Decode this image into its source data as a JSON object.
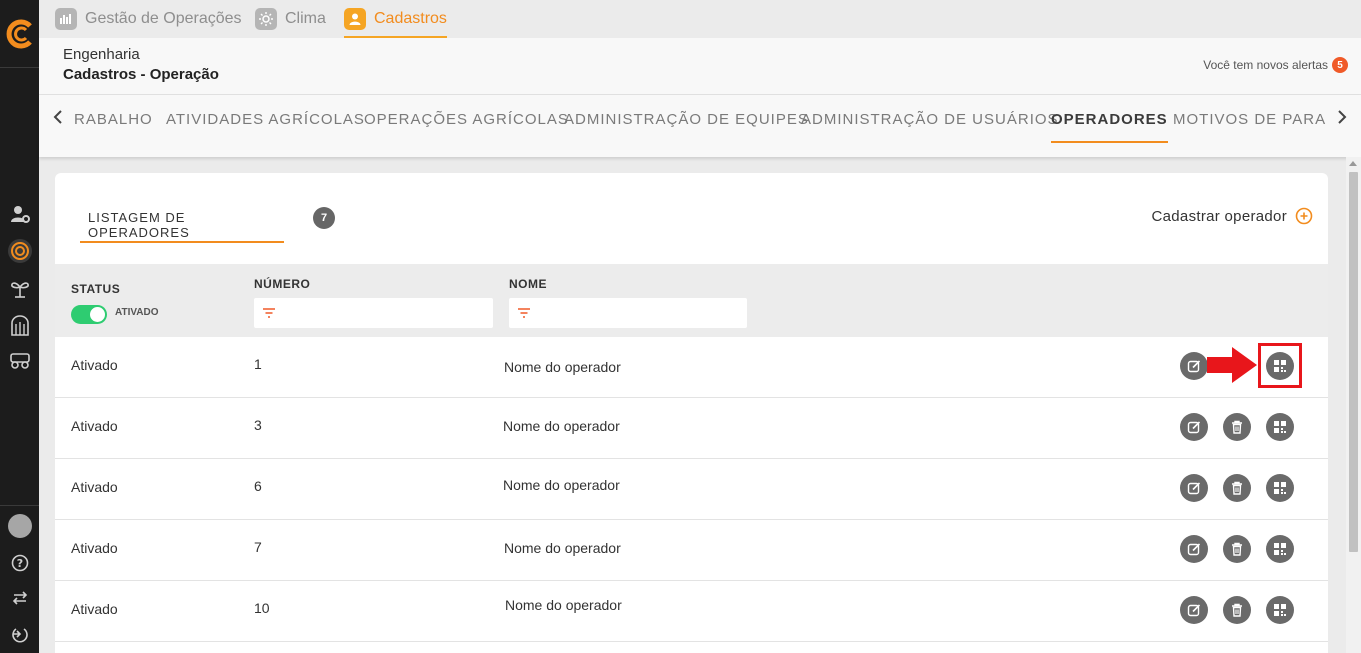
{
  "top_tabs": [
    {
      "label": "Gestão de Operações",
      "icon": "chart-icon"
    },
    {
      "label": "Clima",
      "icon": "sun-icon"
    },
    {
      "label": "Cadastros",
      "icon": "user-icon"
    }
  ],
  "header": {
    "breadcrumb_1": "Engenharia",
    "breadcrumb_2": "Cadastros - Operação",
    "alerts_text": "Você tem novos alertas",
    "alerts_count": "5"
  },
  "sub_tabs": [
    "RABALHO",
    "ATIVIDADES AGRÍCOLAS",
    "OPERAÇÕES AGRÍCOLAS",
    "ADMINISTRAÇÃO DE EQUIPES",
    "ADMINISTRAÇÃO DE USUÁRIOS",
    "OPERADORES",
    "MOTIVOS DE PARADA"
  ],
  "card": {
    "title": "LISTAGEM DE OPERADORES",
    "count": "7",
    "add_label": "Cadastrar operador"
  },
  "table": {
    "headers": {
      "status": "STATUS",
      "numero": "NÚMERO",
      "nome": "NOME"
    },
    "toggle_label": "ATIVADO",
    "rows": [
      {
        "status": "Ativado",
        "numero": "1",
        "nome": "Nome do operador"
      },
      {
        "status": "Ativado",
        "numero": "3",
        "nome": "Nome do operador"
      },
      {
        "status": "Ativado",
        "numero": "6",
        "nome": "Nome do operador"
      },
      {
        "status": "Ativado",
        "numero": "7",
        "nome": "Nome do operador"
      },
      {
        "status": "Ativado",
        "numero": "10",
        "nome": "Nome do operador"
      }
    ]
  },
  "colors": {
    "accent": "#f28c1e",
    "toggle_on": "#2ecc71",
    "alert_badge": "#f05a28",
    "highlight": "#e8161b",
    "rail": "#1c1c1c"
  }
}
